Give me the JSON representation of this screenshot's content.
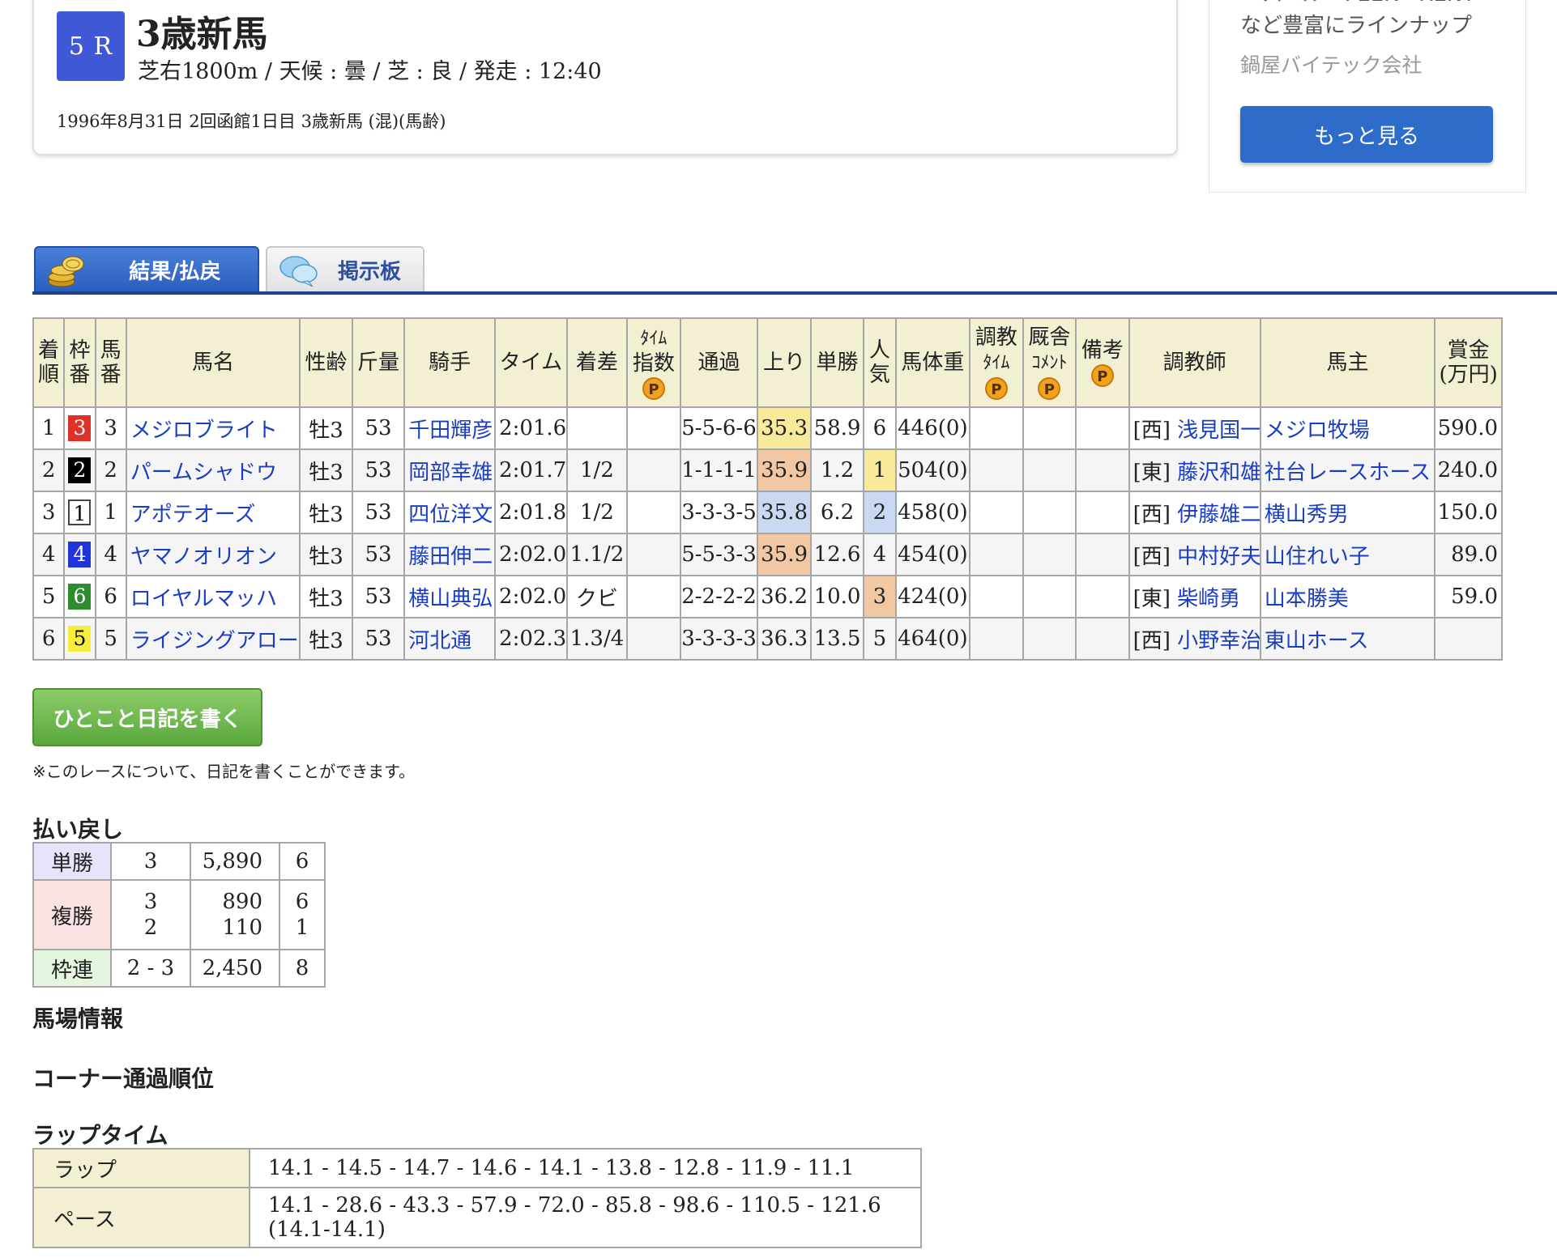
{
  "race": {
    "number": "5 R",
    "title": "3歳新馬",
    "conditions": "芝右1800m / 天候 : 曇 / 芝 : 良 / 発走 : 12:40",
    "date_line": "1996年8月31日 2回函館1日目 3歳新馬  (混)(馬齢)"
  },
  "ad": {
    "line1": "ベスベル・PEEK・RENT",
    "line2": "など豊富にラインナップ",
    "company": "鍋屋バイテック会社",
    "button": "もっと見る"
  },
  "tabs": [
    {
      "label": "結果/払戻",
      "active": true
    },
    {
      "label": "掲示板",
      "active": false
    }
  ],
  "result_headers": {
    "rank": [
      "着",
      "順"
    ],
    "frame": [
      "枠",
      "番"
    ],
    "num": [
      "馬",
      "番"
    ],
    "name": "馬名",
    "sexage": "性齢",
    "weight": "斤量",
    "jockey": "騎手",
    "time": "タイム",
    "margin": "着差",
    "timeindex": [
      "ﾀｲﾑ",
      "指数"
    ],
    "passing": "通過",
    "last3f": "上り",
    "odds": "単勝",
    "pop": [
      "人",
      "気"
    ],
    "bodyweight": "馬体重",
    "training": [
      "調教",
      "ﾀｲﾑ"
    ],
    "stable": [
      "厩舎",
      "ｺﾒﾝﾄ"
    ],
    "note": "備考",
    "trainer": "調教師",
    "owner": "馬主",
    "prize": [
      "賞金",
      "(万円)"
    ]
  },
  "premium_mark": "P",
  "results": [
    {
      "rank": "1",
      "frame": "3",
      "num": "3",
      "name": "メジロブライト",
      "sexage": "牡3",
      "weight": "53",
      "jockey": "千田輝彦",
      "time": "2:01.6",
      "margin": "",
      "passing": "5-5-6-6",
      "last3f": "35.3",
      "odds": "58.9",
      "pop": "6",
      "bodyweight": "446(0)",
      "region": "[西]",
      "trainer": "浅見国一",
      "owner": "メジロ牧場",
      "prize": "590.0"
    },
    {
      "rank": "2",
      "frame": "2",
      "num": "2",
      "name": "パームシャドウ",
      "sexage": "牡3",
      "weight": "53",
      "jockey": "岡部幸雄",
      "time": "2:01.7",
      "margin": "1/2",
      "passing": "1-1-1-1",
      "last3f": "35.9",
      "odds": "1.2",
      "pop": "1",
      "bodyweight": "504(0)",
      "region": "[東]",
      "trainer": "藤沢和雄",
      "owner": "社台レースホース",
      "prize": "240.0"
    },
    {
      "rank": "3",
      "frame": "1",
      "num": "1",
      "name": "アポテオーズ",
      "sexage": "牡3",
      "weight": "53",
      "jockey": "四位洋文",
      "time": "2:01.8",
      "margin": "1/2",
      "passing": "3-3-3-5",
      "last3f": "35.8",
      "odds": "6.2",
      "pop": "2",
      "bodyweight": "458(0)",
      "region": "[西]",
      "trainer": "伊藤雄二",
      "owner": "横山秀男",
      "prize": "150.0"
    },
    {
      "rank": "4",
      "frame": "4",
      "num": "4",
      "name": "ヤマノオリオン",
      "sexage": "牡3",
      "weight": "53",
      "jockey": "藤田伸二",
      "time": "2:02.0",
      "margin": "1.1/2",
      "passing": "5-5-3-3",
      "last3f": "35.9",
      "odds": "12.6",
      "pop": "4",
      "bodyweight": "454(0)",
      "region": "[西]",
      "trainer": "中村好夫",
      "owner": "山住れい子",
      "prize": "89.0"
    },
    {
      "rank": "5",
      "frame": "6",
      "num": "6",
      "name": "ロイヤルマッハ",
      "sexage": "牡3",
      "weight": "53",
      "jockey": "横山典弘",
      "time": "2:02.0",
      "margin": "クビ",
      "passing": "2-2-2-2",
      "last3f": "36.2",
      "odds": "10.0",
      "pop": "3",
      "bodyweight": "424(0)",
      "region": "[東]",
      "trainer": "柴崎勇",
      "owner": "山本勝美",
      "prize": "59.0"
    },
    {
      "rank": "6",
      "frame": "5",
      "num": "5",
      "name": "ライジングアロー",
      "sexage": "牡3",
      "weight": "53",
      "jockey": "河北通",
      "time": "2:02.3",
      "margin": "1.3/4",
      "passing": "3-3-3-3",
      "last3f": "36.3",
      "odds": "13.5",
      "pop": "5",
      "bodyweight": "464(0)",
      "region": "[西]",
      "trainer": "小野幸治",
      "owner": "東山ホース",
      "prize": ""
    }
  ],
  "colors": {
    "frame_1": "#ffffff",
    "frame_2": "#000000",
    "frame_3": "#e0302a",
    "frame_4": "#1f35d8",
    "frame_5": "#f6ee3a",
    "frame_6": "#2e8b2e",
    "last3f_first": "#f9e99a",
    "last3f_second": "#f2c7a4",
    "last3f_third": "#c9d8f3",
    "link": "#1a3ec2",
    "accent": "#1f3f8f"
  },
  "diary": {
    "button": "ひとこと日記を書く",
    "note": "※このレースについて、日記を書くことができます。"
  },
  "payout": {
    "heading": "払い戻し",
    "tan": {
      "label": "単勝",
      "nums": "3",
      "pay": "5,890",
      "pop": "6"
    },
    "fuku": {
      "label": "複勝",
      "nums": [
        "3",
        "2"
      ],
      "pay": [
        "890",
        "110"
      ],
      "pop": [
        "6",
        "1"
      ]
    },
    "waku": {
      "label": "枠連",
      "nums": "2 - 3",
      "pay": "2,450",
      "pop": "8"
    }
  },
  "track_info": {
    "heading": "馬場情報"
  },
  "corner": {
    "heading": "コーナー通過順位"
  },
  "laps": {
    "heading": "ラップタイム",
    "lap_label": "ラップ",
    "lap_value": "14.1 - 14.5 - 14.7 - 14.6 - 14.1 - 13.8 - 12.8 - 11.9 - 11.1",
    "pace_label": "ペース",
    "pace_value": "14.1 - 28.6 - 43.3 - 57.9 - 72.0 - 85.8 - 98.6 - 110.5 - 121.6 (14.1-14.1)"
  }
}
